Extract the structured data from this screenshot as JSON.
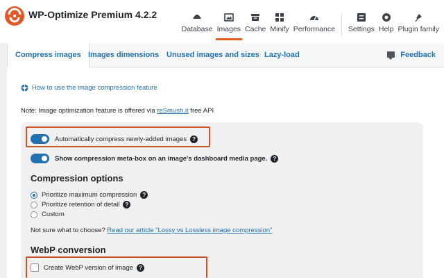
{
  "app": {
    "title": "WP-Optimize Premium 4.2.2"
  },
  "nav": [
    {
      "label": "Database",
      "icon": "database-icon"
    },
    {
      "label": "Images",
      "icon": "images-icon",
      "active": true
    },
    {
      "label": "Cache",
      "icon": "cache-icon"
    },
    {
      "label": "Minify",
      "icon": "minify-icon"
    },
    {
      "label": "Performance",
      "icon": "performance-icon"
    },
    {
      "label": "Settings",
      "icon": "settings-icon"
    },
    {
      "label": "Help",
      "icon": "help-icon"
    },
    {
      "label": "Plugin family",
      "icon": "plugin-family-icon"
    }
  ],
  "tabs": [
    {
      "label": "Compress images",
      "active": true
    },
    {
      "label": "Images dimensions"
    },
    {
      "label": "Unused images and sizes"
    },
    {
      "label": "Lazy-load"
    }
  ],
  "feedback": {
    "label": "Feedback",
    "icon": "comment-icon"
  },
  "howto": {
    "label": "How to use the image compression feature",
    "icon": "lifebuoy-icon"
  },
  "note": {
    "prefix": "Note: Image optimization feature is offered via ",
    "link": "reSmush.it",
    "suffix": " free API"
  },
  "options": {
    "auto_compress": {
      "label": "Automatically compress newly-added images",
      "enabled": true
    },
    "meta_box": {
      "label": "Show compression meta-box on an image's dashboard media page.",
      "enabled": true
    }
  },
  "compression": {
    "title": "Compression options",
    "choices": [
      {
        "label": "Prioritize maximum compression",
        "checked": true,
        "help": true
      },
      {
        "label": "Prioritize retention of detail",
        "checked": false,
        "help": true
      },
      {
        "label": "Custom",
        "checked": false,
        "help": false
      }
    ],
    "hint_prefix": "Not sure what to choose? ",
    "hint_link": "Read our article \"Lossy vs Lossless image compression\""
  },
  "webp": {
    "title": "WebP conversion",
    "checkbox_label": "Create WebP version of image",
    "checked": false
  },
  "help_glyph": "?",
  "colors": {
    "accent": "#e75c1d",
    "link": "#2271b1",
    "highlight": "#c9572a"
  }
}
